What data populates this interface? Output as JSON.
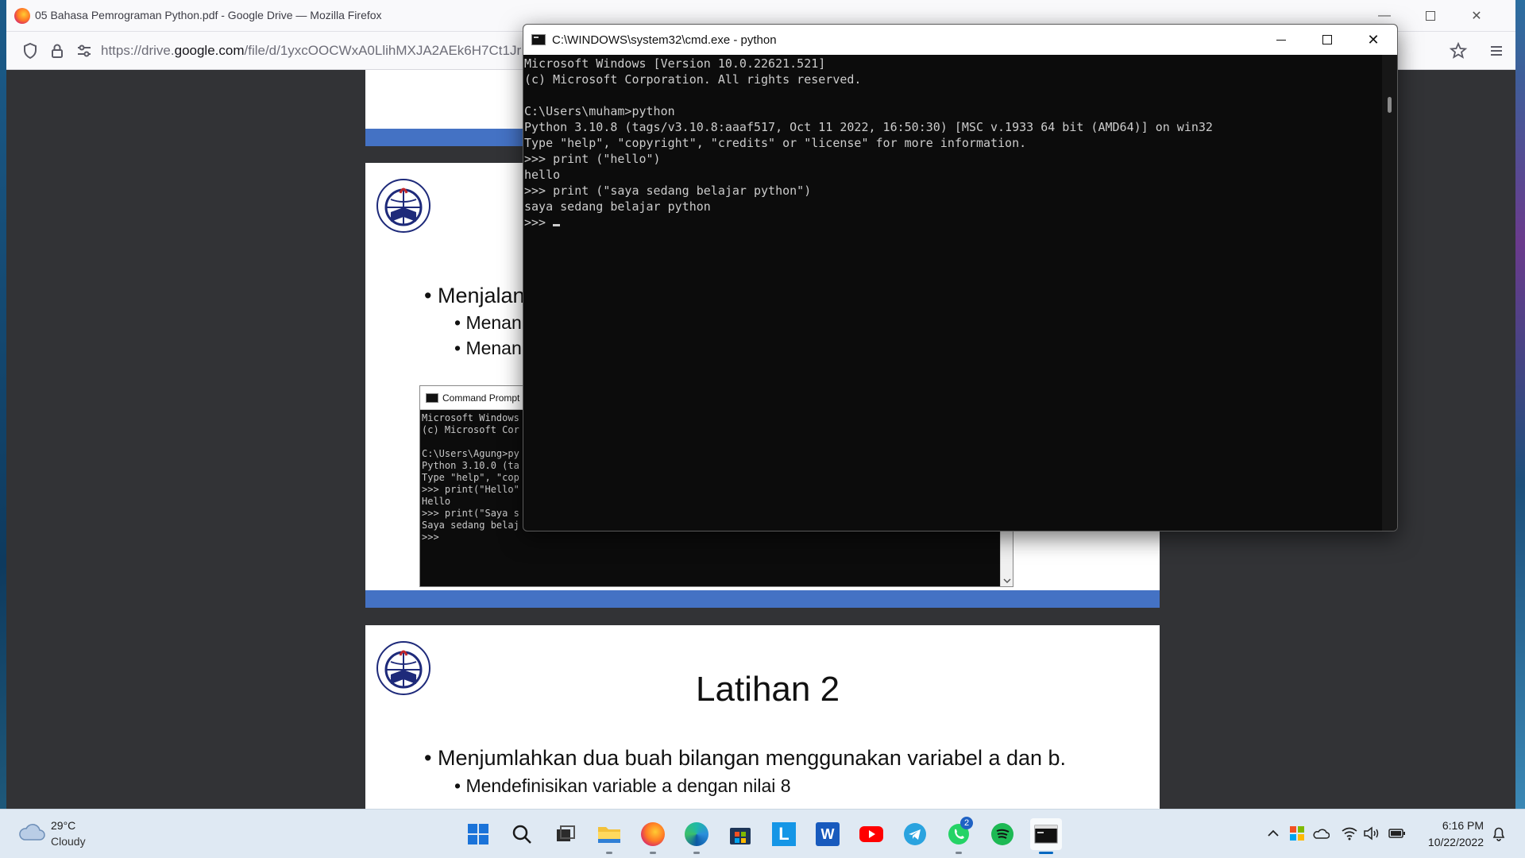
{
  "firefox": {
    "title": "05 Bahasa Pemrograman Python.pdf - Google Drive — Mozilla Firefox",
    "url_prefix": "https://drive.",
    "url_domain": "google.com",
    "url_path": "/file/d/1yxcOOCWxA0LlihMXJA2AEk6H7Ct1Jr"
  },
  "slide2": {
    "bullet1": "• Menjalan",
    "sub1": "• Menan",
    "sub2": "• Menan",
    "mini_cmd_title": "Command Prompt -",
    "mini_cmd_lines": "Microsoft Windows\n(c) Microsoft Cor\n\nC:\\Users\\Agung>py\nPython 3.10.0 (ta\nType \"help\", \"cop\n>>> print(\"Hello\"\nHello\n>>> print(\"Saya s\nSaya sedang belaj\n>>>"
  },
  "slide3": {
    "title": "Latihan 2",
    "bullet1": "• Menjumlahkan dua buah bilangan menggunakan variabel a dan b.",
    "sub1": "• Mendefinisikan variable a dengan nilai 8"
  },
  "cmd": {
    "title": "C:\\WINDOWS\\system32\\cmd.exe - python",
    "output": "Microsoft Windows [Version 10.0.22621.521]\n(c) Microsoft Corporation. All rights reserved.\n\nC:\\Users\\muham>python\nPython 3.10.8 (tags/v3.10.8:aaaf517, Oct 11 2022, 16:50:30) [MSC v.1933 64 bit (AMD64)] on win32\nType \"help\", \"copyright\", \"credits\" or \"license\" for more information.\n>>> print (\"hello\")\nhello\n>>> print (\"saya sedang belajar python\")\nsaya sedang belajar python\n",
    "prompt": ">>> "
  },
  "taskbar": {
    "weather_temp": "29°C",
    "weather_desc": "Cloudy",
    "whatsapp_badge": "2",
    "time": "6:16 PM",
    "date": "10/22/2022"
  },
  "colors": {
    "slide_bar": "#4472c4",
    "cmd_bg": "#0c0c0c",
    "taskbar_bg": "#dfe9f3"
  }
}
